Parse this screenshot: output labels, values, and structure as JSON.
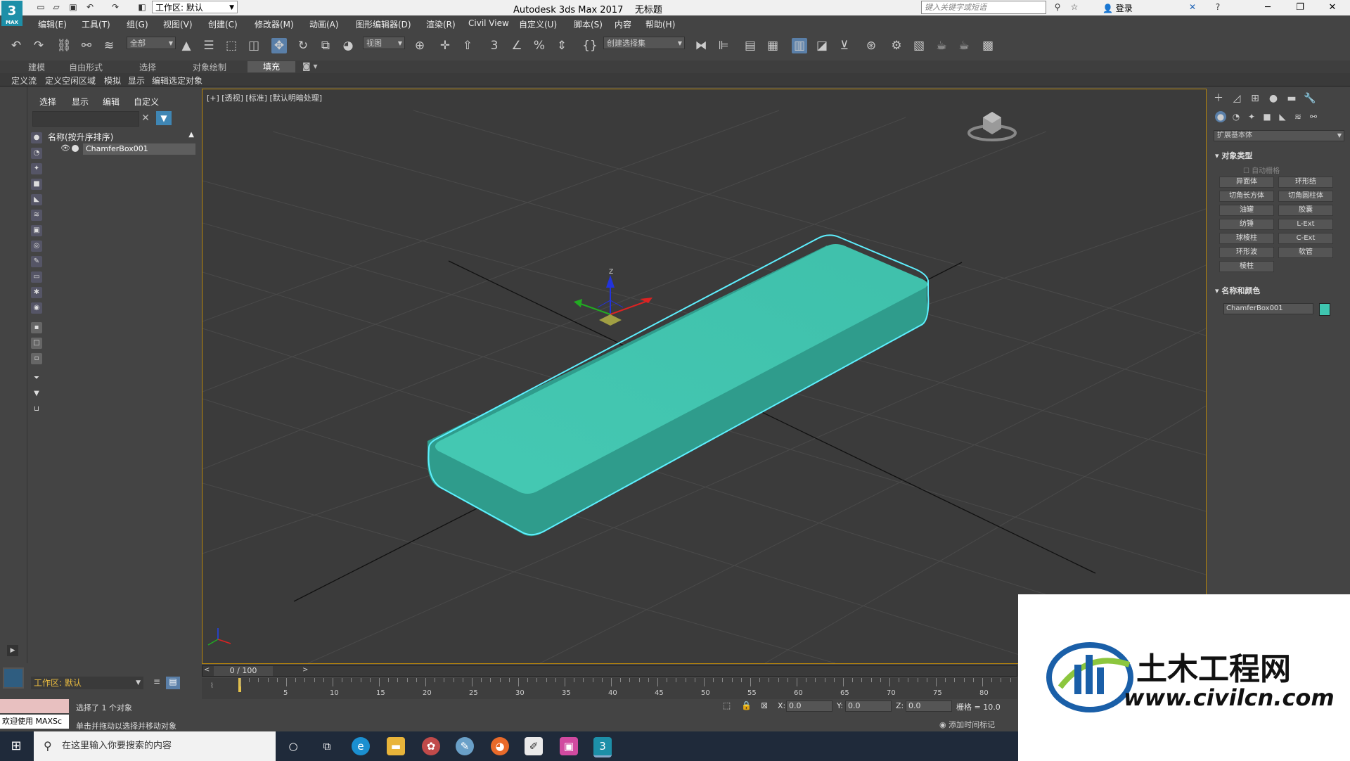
{
  "titlebar": {
    "logo_main": "3",
    "logo_sub": "MAX",
    "workspace_label": "工作区: 默认",
    "app_title": "Autodesk 3ds Max 2017",
    "doc_title": "无标题",
    "search_placeholder": "键入关键字或短语",
    "login": "登录"
  },
  "menus": [
    "编辑(E)",
    "工具(T)",
    "组(G)",
    "视图(V)",
    "创建(C)",
    "修改器(M)",
    "动画(A)",
    "图形编辑器(D)",
    "渲染(R)",
    "Civil View",
    "自定义(U)",
    "脚本(S)",
    "内容",
    "帮助(H)"
  ],
  "toolbar": {
    "filter_value": "全部",
    "refcoord_value": "视图",
    "selset_value": "创建选择集"
  },
  "ribbon_tabs": [
    "建模",
    "自由形式",
    "选择",
    "对象绘制",
    "填充"
  ],
  "sub_ribbon": [
    "定义流",
    "定义空闲区域",
    "模拟",
    "显示",
    "编辑选定对象"
  ],
  "explorer": {
    "tabs": [
      "选择",
      "显示",
      "编辑",
      "自定义"
    ],
    "header": "名称(按升序排序)",
    "objects": [
      "ChamferBox001"
    ]
  },
  "viewport": {
    "label": "[+] [透视] [标准] [默认明暗处理]",
    "object_color": "#3fc6b0",
    "selection_color": "#5ef0ff"
  },
  "command_panel": {
    "dropdown": "扩展基本体",
    "section_object_type": "对象类型",
    "autogrid": "自动栅格",
    "buttons": [
      "异面体",
      "环形结",
      "切角长方体",
      "切角圆柱体",
      "油罐",
      "胶囊",
      "纺锤",
      "L-Ext",
      "球棱柱",
      "C-Ext",
      "环形波",
      "软管",
      "棱柱"
    ],
    "section_name_color": "名称和颜色",
    "name_value": "ChamferBox001"
  },
  "timeline": {
    "slider_label": "0 / 100",
    "ticks": [
      "5",
      "10",
      "15",
      "20",
      "25",
      "30",
      "35",
      "40",
      "45",
      "50",
      "55",
      "60",
      "65",
      "70",
      "75",
      "80"
    ]
  },
  "status": {
    "workspace": "工作区: 默认",
    "welcome": "欢迎使用 MAXSc",
    "line1": "选择了 1 个对象",
    "line2": "单击并拖动以选择并移动对象",
    "x_label": "X:",
    "x_value": "0.0",
    "y_label": "Y:",
    "y_value": "0.0",
    "z_label": "Z:",
    "z_value": "0.0",
    "grid": "栅格 = 10.0",
    "add_time_tag": "添加时间标记"
  },
  "taskbar": {
    "search_placeholder": "在这里输入你要搜索的内容"
  },
  "watermark": {
    "text": "土木工程网",
    "url": "www.civilcn.com"
  }
}
